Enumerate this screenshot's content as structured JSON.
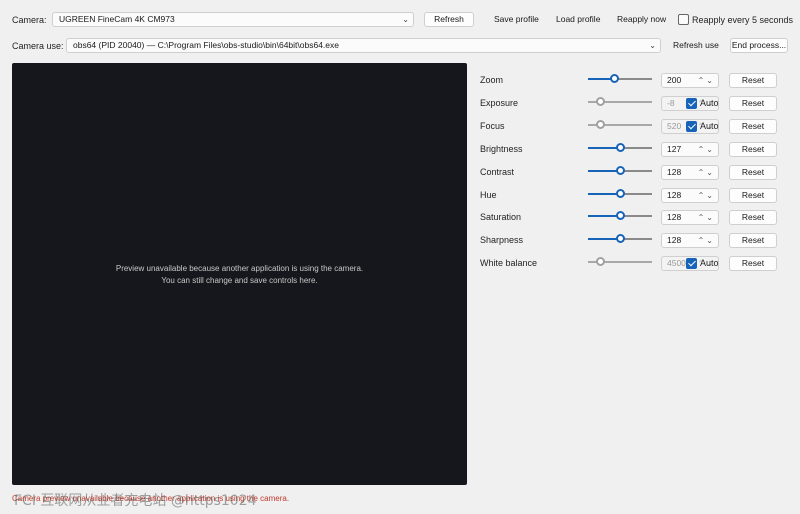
{
  "top": {
    "camera_label": "Camera:",
    "camera_value": "UGREEN FineCam 4K CM973",
    "refresh_label": "Refresh",
    "save_profile_label": "Save profile",
    "load_profile_label": "Load profile",
    "reapply_now_label": "Reapply now",
    "reapply_every_label": "Reapply every 5 seconds",
    "camera_use_label": "Camera use:",
    "camera_use_value": "obs64 (PID 20040) — C:\\Program Files\\obs-studio\\bin\\64bit\\obs64.exe",
    "refresh_use_label": "Refresh use",
    "end_process_label": "End process..."
  },
  "preview": {
    "line1": "Preview unavailable because another application is using the camera.",
    "line2": "You can still change and save controls here."
  },
  "controls": [
    {
      "label": "Zoom",
      "value": "200",
      "level": 0.4,
      "auto": null,
      "disabled": false,
      "reset": "Reset"
    },
    {
      "label": "Exposure",
      "value": "-8",
      "level": 0.15,
      "auto": "Auto",
      "disabled": true,
      "reset": "Reset"
    },
    {
      "label": "Focus",
      "value": "520",
      "level": 0.15,
      "auto": "Auto",
      "disabled": true,
      "reset": "Reset"
    },
    {
      "label": "Brightness",
      "value": "127",
      "level": 0.5,
      "auto": null,
      "disabled": false,
      "reset": "Reset"
    },
    {
      "label": "Contrast",
      "value": "128",
      "level": 0.5,
      "auto": null,
      "disabled": false,
      "reset": "Reset"
    },
    {
      "label": "Hue",
      "value": "128",
      "level": 0.5,
      "auto": null,
      "disabled": false,
      "reset": "Reset"
    },
    {
      "label": "Saturation",
      "value": "128",
      "level": 0.5,
      "auto": null,
      "disabled": false,
      "reset": "Reset"
    },
    {
      "label": "Sharpness",
      "value": "128",
      "level": 0.5,
      "auto": null,
      "disabled": false,
      "reset": "Reset"
    },
    {
      "label": "White balance",
      "value": "4500",
      "level": 0.15,
      "auto": "Auto",
      "disabled": true,
      "reset": "Reset"
    }
  ],
  "status": "Camera preview unavailable because another application is using the camera.",
  "watermark": "FCI 互联网从业者充电站 @https1024",
  "colors": {
    "accent": "#1763b8",
    "preview_bg": "#15171c",
    "status": "#c0392b"
  }
}
